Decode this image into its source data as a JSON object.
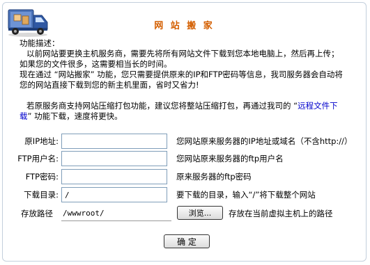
{
  "header": {
    "title": "网 站 搬 家",
    "logo_icon": "moving-truck-icon"
  },
  "description": {
    "heading": "功能描述：",
    "line1": "以前网站要更换主机服务商，需要先将所有网站文件下载到您本地电脑上，然后再上传；",
    "line2": "如果您的文件很多，这需要相当长的时间。",
    "line3": "现在通过 “网站搬家” 功能，您只需要提供原来的IP和FTP密码等信息，我司服务器会自动将",
    "line4": "您的网站直接下载到您的新主机里面，省时又省力!",
    "line5_before": "若原服务商支持网站压缩打包功能，建议您将整站压缩打包，再通过我司的 “",
    "line5_link": "远程文件下",
    "line6_link": "载",
    "line6_after": "” 功能下载，速度将更快。"
  },
  "form": {
    "ip": {
      "label": "原IP地址:",
      "value": "",
      "hint": "您网站原来服务器的IP地址或域名（不含http://）"
    },
    "ftp_user": {
      "label": "FTP用户名:",
      "value": "",
      "hint": "您网站原来服务器的ftp用户名"
    },
    "ftp_pass": {
      "label": "FTP密码:",
      "value": "",
      "hint": "原来服务器的ftp密码"
    },
    "download_dir": {
      "label": "下载目录:",
      "value": "/",
      "hint": "要下载的目录，输入“/”将下载整个网站"
    },
    "save_path": {
      "label": "存放路径",
      "value": "/wwwroot/",
      "browse_label": "浏览...",
      "hint": "存放在当前虚拟主机上的路径"
    },
    "submit_label": "确 定"
  }
}
